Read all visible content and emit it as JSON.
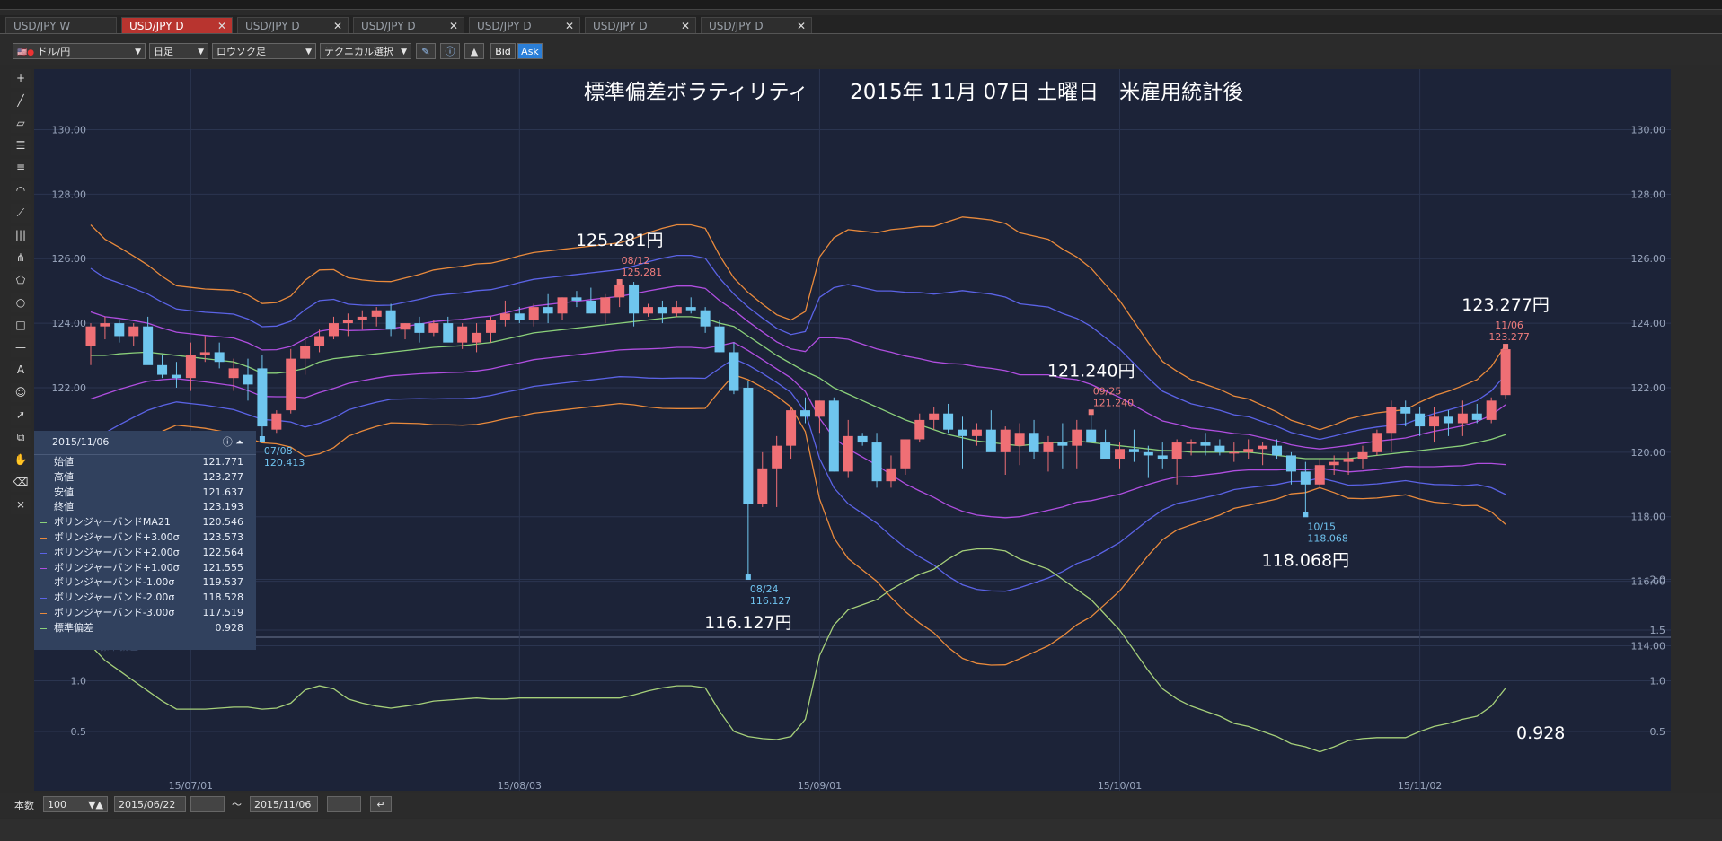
{
  "tabs": [
    {
      "label": "USD/JPY W",
      "active": false
    },
    {
      "label": "USD/JPY D",
      "active": true
    },
    {
      "label": "USD/JPY D",
      "active": false
    },
    {
      "label": "USD/JPY D",
      "active": false
    },
    {
      "label": "USD/JPY D",
      "active": false
    },
    {
      "label": "USD/JPY D",
      "active": false
    },
    {
      "label": "USD/JPY D",
      "active": false
    }
  ],
  "toolbar": {
    "pair": "ドル/円",
    "period": "日足",
    "style": "ロウソク足",
    "technical": "テクニカル選択",
    "bid": "Bid",
    "ask": "Ask"
  },
  "info": {
    "date": "2015/11/06",
    "rows": [
      {
        "label": "始値",
        "value": "121.771"
      },
      {
        "label": "高値",
        "value": "123.277"
      },
      {
        "label": "安値",
        "value": "121.637"
      },
      {
        "label": "終値",
        "value": "123.193"
      },
      {
        "label": "ボリンジャーバンドMA21",
        "value": "120.546",
        "color": "#8bd07a"
      },
      {
        "label": "ボリンジャーバンド+3.00σ",
        "value": "123.573",
        "color": "#e98a3c"
      },
      {
        "label": "ボリンジャーバンド+2.00σ",
        "value": "122.564",
        "color": "#5b63e6"
      },
      {
        "label": "ボリンジャーバンド+1.00σ",
        "value": "121.555",
        "color": "#b04ee0"
      },
      {
        "label": "ボリンジャーバンド-1.00σ",
        "value": "119.537",
        "color": "#b04ee0"
      },
      {
        "label": "ボリンジャーバンド-2.00σ",
        "value": "118.528",
        "color": "#5b63e6"
      },
      {
        "label": "ボリンジャーバンド-3.00σ",
        "value": "117.519",
        "color": "#e98a3c"
      },
      {
        "label": "標準偏差",
        "value": "0.928",
        "color": "#8bd07a"
      }
    ]
  },
  "bottombar": {
    "count_label": "本数",
    "count": "100",
    "from": "2015/06/22",
    "tilde": "～",
    "to": "2015/11/06"
  },
  "chart_data": {
    "type": "candlestick",
    "title": "標準偏差ボラティリティ　　2015年 11月 07日 土曜日　米雇用統計後",
    "main": {
      "ylim": [
        113.5,
        131.0
      ],
      "yticks": [
        "130.00",
        "128.00",
        "126.00",
        "124.00",
        "122.00",
        "120.00",
        "118.00",
        "116.00",
        "114.00"
      ],
      "candles": [
        [
          123.3,
          124.0,
          122.7,
          123.9
        ],
        [
          123.9,
          124.2,
          123.5,
          124.0
        ],
        [
          124.0,
          124.1,
          123.4,
          123.6
        ],
        [
          123.6,
          124.0,
          123.3,
          123.9
        ],
        [
          123.9,
          124.2,
          123.0,
          122.7
        ],
        [
          122.7,
          123.0,
          122.3,
          122.4
        ],
        [
          122.4,
          122.8,
          122.0,
          122.3
        ],
        [
          122.3,
          123.4,
          121.9,
          123.0
        ],
        [
          123.0,
          123.6,
          122.8,
          123.1
        ],
        [
          123.1,
          123.4,
          122.6,
          122.8
        ],
        [
          122.3,
          122.9,
          121.9,
          122.6
        ],
        [
          122.4,
          122.9,
          121.6,
          122.1
        ],
        [
          122.6,
          123.0,
          120.413,
          120.8
        ],
        [
          120.7,
          121.3,
          120.6,
          121.2
        ],
        [
          121.3,
          123.2,
          121.2,
          122.9
        ],
        [
          122.9,
          123.5,
          122.4,
          123.3
        ],
        [
          123.3,
          123.8,
          123.1,
          123.6
        ],
        [
          123.6,
          124.2,
          123.5,
          124.0
        ],
        [
          124.0,
          124.3,
          123.6,
          124.1
        ],
        [
          124.1,
          124.4,
          123.8,
          124.2
        ],
        [
          124.2,
          124.5,
          123.9,
          124.4
        ],
        [
          124.4,
          124.6,
          123.6,
          123.8
        ],
        [
          123.8,
          124.0,
          123.5,
          124.0
        ],
        [
          124.0,
          124.2,
          123.4,
          123.7
        ],
        [
          123.7,
          124.1,
          123.6,
          124.0
        ],
        [
          124.0,
          124.2,
          123.7,
          123.4
        ],
        [
          123.4,
          124.0,
          123.2,
          123.9
        ],
        [
          123.4,
          124.0,
          123.1,
          123.7
        ],
        [
          123.7,
          124.2,
          123.4,
          124.1
        ],
        [
          124.1,
          124.7,
          123.9,
          124.3
        ],
        [
          124.3,
          124.5,
          124.0,
          124.1
        ],
        [
          124.1,
          124.6,
          123.9,
          124.5
        ],
        [
          124.5,
          124.9,
          124.0,
          124.3
        ],
        [
          124.3,
          124.8,
          124.1,
          124.8
        ],
        [
          124.8,
          125.0,
          124.5,
          124.7
        ],
        [
          124.7,
          125.1,
          124.3,
          124.3
        ],
        [
          124.3,
          124.9,
          124.0,
          124.8
        ],
        [
          124.8,
          125.281,
          124.5,
          125.2
        ],
        [
          125.2,
          125.281,
          123.9,
          124.3
        ],
        [
          124.3,
          124.6,
          124.2,
          124.5
        ],
        [
          124.5,
          124.7,
          124.0,
          124.3
        ],
        [
          124.3,
          124.7,
          124.2,
          124.5
        ],
        [
          124.5,
          124.8,
          124.3,
          124.4
        ],
        [
          124.4,
          124.5,
          123.7,
          123.9
        ],
        [
          123.9,
          124.1,
          123.1,
          123.1
        ],
        [
          123.1,
          123.4,
          121.8,
          121.9
        ],
        [
          122.0,
          122.2,
          116.127,
          118.4
        ],
        [
          118.4,
          120.0,
          118.3,
          119.5
        ],
        [
          119.5,
          120.5,
          118.3,
          120.2
        ],
        [
          120.2,
          121.4,
          119.8,
          121.3
        ],
        [
          121.3,
          121.7,
          120.9,
          121.1
        ],
        [
          121.1,
          121.6,
          120.6,
          121.6
        ],
        [
          121.6,
          121.7,
          119.4,
          119.4
        ],
        [
          119.4,
          121.0,
          119.2,
          120.5
        ],
        [
          120.5,
          120.6,
          120.2,
          120.3
        ],
        [
          120.3,
          120.6,
          118.9,
          119.1
        ],
        [
          119.1,
          119.9,
          118.9,
          119.5
        ],
        [
          119.5,
          120.4,
          119.3,
          120.4
        ],
        [
          120.4,
          121.2,
          120.3,
          121.0
        ],
        [
          121.0,
          121.4,
          120.7,
          121.2
        ],
        [
          121.2,
          121.5,
          120.6,
          120.7
        ],
        [
          120.7,
          121.1,
          119.5,
          120.5
        ],
        [
          120.5,
          120.9,
          120.2,
          120.7
        ],
        [
          120.7,
          121.3,
          120.3,
          120.0
        ],
        [
          120.0,
          120.8,
          119.3,
          120.7
        ],
        [
          120.2,
          120.9,
          119.6,
          120.6
        ],
        [
          120.6,
          121.0,
          119.8,
          120.0
        ],
        [
          120.0,
          120.5,
          119.4,
          120.3
        ],
        [
          120.3,
          120.9,
          119.5,
          120.2
        ],
        [
          120.2,
          121.0,
          119.5,
          120.7
        ],
        [
          120.7,
          121.24,
          120.4,
          120.3
        ],
        [
          120.3,
          120.7,
          119.9,
          119.8
        ],
        [
          119.8,
          120.3,
          119.5,
          120.1
        ],
        [
          120.1,
          120.7,
          119.7,
          120.0
        ],
        [
          120.0,
          120.2,
          119.2,
          119.9
        ],
        [
          119.9,
          120.3,
          119.5,
          119.8
        ],
        [
          119.8,
          120.4,
          119.0,
          120.3
        ],
        [
          120.3,
          120.4,
          119.9,
          120.3
        ],
        [
          120.3,
          120.6,
          119.9,
          120.2
        ],
        [
          120.2,
          120.4,
          119.9,
          120.0
        ],
        [
          120.0,
          120.3,
          119.7,
          120.0
        ],
        [
          120.0,
          120.4,
          119.8,
          120.1
        ],
        [
          120.1,
          120.3,
          119.6,
          120.2
        ],
        [
          120.2,
          120.4,
          119.8,
          119.9
        ],
        [
          119.9,
          120.0,
          119.0,
          119.4
        ],
        [
          119.4,
          119.7,
          118.068,
          119.0
        ],
        [
          119.0,
          119.8,
          118.9,
          119.6
        ],
        [
          119.6,
          119.9,
          119.3,
          119.7
        ],
        [
          119.7,
          120.0,
          119.3,
          119.8
        ],
        [
          119.8,
          120.2,
          119.5,
          120.0
        ],
        [
          120.0,
          120.7,
          119.9,
          120.6
        ],
        [
          120.6,
          121.6,
          120.0,
          121.4
        ],
        [
          121.4,
          121.6,
          120.8,
          121.2
        ],
        [
          121.2,
          121.4,
          120.5,
          120.8
        ],
        [
          120.8,
          121.4,
          120.3,
          121.1
        ],
        [
          121.1,
          121.3,
          120.5,
          120.9
        ],
        [
          120.9,
          121.6,
          120.5,
          121.2
        ],
        [
          121.2,
          121.5,
          120.9,
          121.0
        ],
        [
          121.0,
          121.7,
          120.9,
          121.6
        ],
        [
          121.771,
          123.277,
          121.637,
          123.193
        ]
      ],
      "ma21": [
        123.0,
        123.0,
        123.05,
        123.08,
        123.1,
        123.05,
        123.0,
        122.95,
        122.9,
        122.85,
        122.8,
        122.65,
        122.45,
        122.45,
        122.5,
        122.6,
        122.8,
        122.9,
        122.95,
        123.0,
        123.05,
        123.1,
        123.15,
        123.2,
        123.25,
        123.28,
        123.3,
        123.35,
        123.4,
        123.5,
        123.6,
        123.7,
        123.75,
        123.8,
        123.85,
        123.9,
        123.95,
        124.0,
        124.05,
        124.1,
        124.15,
        124.2,
        124.2,
        124.15,
        124.0,
        123.9,
        123.6,
        123.3,
        123.0,
        122.75,
        122.5,
        122.3,
        122.0,
        121.8,
        121.6,
        121.4,
        121.2,
        121.0,
        120.85,
        120.7,
        120.55,
        120.45,
        120.35,
        120.3,
        120.25,
        120.2,
        120.25,
        120.3,
        120.3,
        120.35,
        120.3,
        120.25,
        120.2,
        120.15,
        120.1,
        120.05,
        120.05,
        120.0,
        120.0,
        120.0,
        120.0,
        120.0,
        119.95,
        119.9,
        119.85,
        119.8,
        119.8,
        119.8,
        119.8,
        119.85,
        119.9,
        119.95,
        120.0,
        120.05,
        120.1,
        120.15,
        120.2,
        120.3,
        120.4,
        120.546
      ],
      "std": [
        1.35,
        1.2,
        1.1,
        1.0,
        0.9,
        0.8,
        0.72,
        0.72,
        0.72,
        0.73,
        0.74,
        0.74,
        0.72,
        0.73,
        0.78,
        0.91,
        0.95,
        0.92,
        0.82,
        0.78,
        0.75,
        0.73,
        0.75,
        0.77,
        0.8,
        0.81,
        0.82,
        0.83,
        0.82,
        0.82,
        0.83,
        0.83,
        0.83,
        0.83,
        0.83,
        0.83,
        0.83,
        0.83,
        0.86,
        0.9,
        0.93,
        0.95,
        0.95,
        0.93,
        0.7,
        0.5,
        0.45,
        0.43,
        0.42,
        0.45,
        0.62,
        1.25,
        1.55,
        1.7,
        1.75,
        1.8,
        1.9,
        1.98,
        2.05,
        2.1,
        2.2,
        2.28,
        2.3,
        2.3,
        2.28,
        2.2,
        2.15,
        2.1,
        2.0,
        1.9,
        1.8,
        1.65,
        1.5,
        1.3,
        1.1,
        0.92,
        0.82,
        0.75,
        0.7,
        0.65,
        0.58,
        0.55,
        0.5,
        0.45,
        0.38,
        0.35,
        0.3,
        0.35,
        0.41,
        0.43,
        0.44,
        0.44,
        0.44,
        0.5,
        0.55,
        0.58,
        0.62,
        0.65,
        0.75,
        0.928
      ]
    },
    "sub": {
      "label": "標準偏差",
      "ylim": [
        0.2,
        2.5
      ],
      "yticks": [
        "2.0",
        "1.5",
        "1.0",
        "0.5"
      ]
    },
    "xticks": [
      {
        "index": 7,
        "label": "15/07/01"
      },
      {
        "index": 30,
        "label": "15/08/03"
      },
      {
        "index": 51,
        "label": "15/09/01"
      },
      {
        "index": 72,
        "label": "15/10/01"
      },
      {
        "index": 93,
        "label": "15/11/02"
      }
    ],
    "point_labels": [
      {
        "index": 12,
        "date": "07/08",
        "value": "120.413",
        "color": "#6fc3ef",
        "big": ""
      },
      {
        "index": 37,
        "date": "08/12",
        "value": "125.281",
        "color": "#f07d7d",
        "big": "125.281円"
      },
      {
        "index": 46,
        "date": "08/24",
        "value": "116.127",
        "color": "#6fc3ef",
        "big": "116.127円"
      },
      {
        "index": 70,
        "date": "09/25",
        "value": "121.240",
        "color": "#f07d7d",
        "big": "121.240円"
      },
      {
        "index": 85,
        "date": "10/15",
        "value": "118.068",
        "color": "#6fc3ef",
        "big": "118.068円"
      },
      {
        "index": 99,
        "date": "11/06",
        "value": "123.277",
        "color": "#f07d7d",
        "big": "123.277円"
      }
    ],
    "std_label": "0.928",
    "colors": {
      "up": "#ef6f75",
      "down": "#6fc6ee",
      "ma": "#8bd07a",
      "s1": "#b04ee0",
      "s2": "#5b63e6",
      "s3": "#e98a3c",
      "std": "#a6d07a",
      "bg": "#1c2338"
    }
  }
}
